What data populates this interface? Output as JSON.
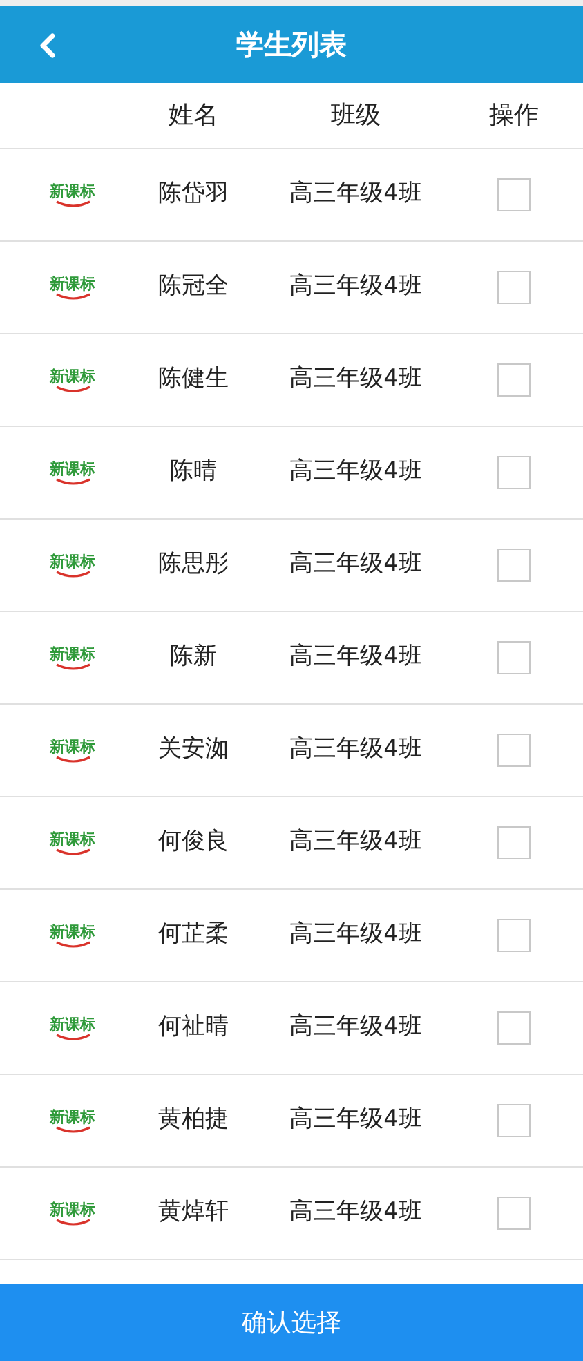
{
  "header": {
    "title": "学生列表"
  },
  "columns": [
    "姓名",
    "班级",
    "操作"
  ],
  "rows": [
    {
      "logo_text": "新课标",
      "name": "陈岱羽",
      "class": "高三年级4班",
      "checked": false
    },
    {
      "logo_text": "新课标",
      "name": "陈冠全",
      "class": "高三年级4班",
      "checked": false
    },
    {
      "logo_text": "新课标",
      "name": "陈健生",
      "class": "高三年级4班",
      "checked": false
    },
    {
      "logo_text": "新课标",
      "name": "陈晴",
      "class": "高三年级4班",
      "checked": false
    },
    {
      "logo_text": "新课标",
      "name": "陈思彤",
      "class": "高三年级4班",
      "checked": false
    },
    {
      "logo_text": "新课标",
      "name": "陈新",
      "class": "高三年级4班",
      "checked": false
    },
    {
      "logo_text": "新课标",
      "name": "关安洳",
      "class": "高三年级4班",
      "checked": false
    },
    {
      "logo_text": "新课标",
      "name": "何俊良",
      "class": "高三年级4班",
      "checked": false
    },
    {
      "logo_text": "新课标",
      "name": "何芷柔",
      "class": "高三年级4班",
      "checked": false
    },
    {
      "logo_text": "新课标",
      "name": "何祉晴",
      "class": "高三年级4班",
      "checked": false
    },
    {
      "logo_text": "新课标",
      "name": "黄柏捷",
      "class": "高三年级4班",
      "checked": false
    },
    {
      "logo_text": "新课标",
      "name": "黄焯轩",
      "class": "高三年级4班",
      "checked": false
    }
  ],
  "confirm_button": "确认选择"
}
